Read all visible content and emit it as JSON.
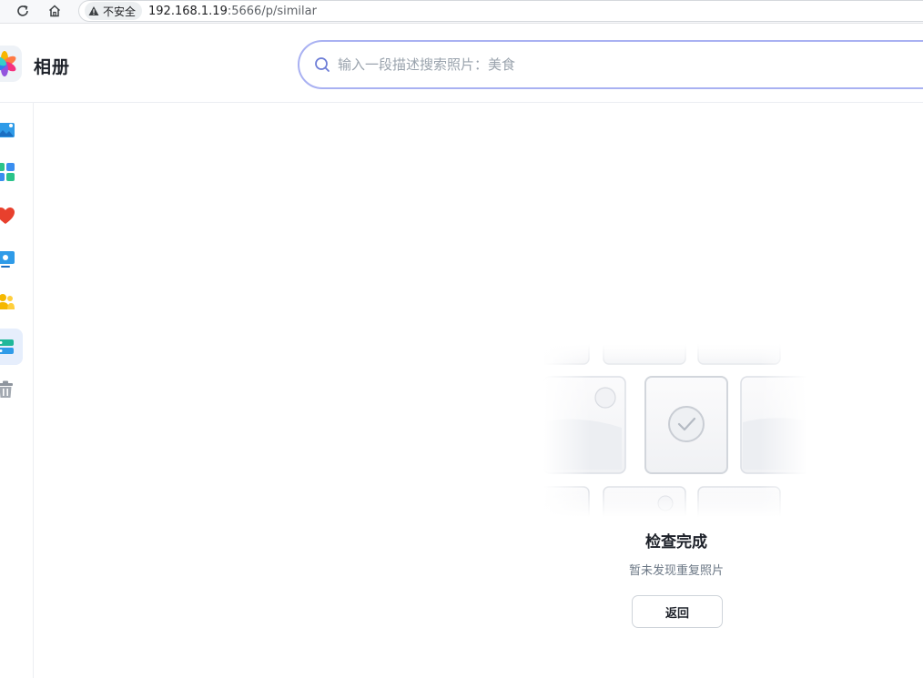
{
  "browser": {
    "security_label": "不安全",
    "url_host": "192.168.1.19",
    "url_rest": ":5666/p/similar"
  },
  "app": {
    "title": "相册"
  },
  "search": {
    "placeholder": "输入一段描述搜索照片：美食"
  },
  "sidebar": {
    "items": [
      {
        "icon": "photos-icon",
        "active": false
      },
      {
        "icon": "albums-icon",
        "active": false
      },
      {
        "icon": "favorites-heart-icon",
        "active": false
      },
      {
        "icon": "computer-icon",
        "active": false
      },
      {
        "icon": "people-icon",
        "active": false
      },
      {
        "icon": "similar-photos-icon",
        "active": true
      },
      {
        "icon": "trash-icon",
        "active": false
      }
    ]
  },
  "empty_state": {
    "title": "检查完成",
    "subtitle": "暂未发现重复照片",
    "back_label": "返回"
  },
  "colors": {
    "search_border": "#a9b1f2",
    "active_bg": "#e6eefc",
    "text_primary": "#1d2129",
    "text_secondary": "#6b7785"
  }
}
